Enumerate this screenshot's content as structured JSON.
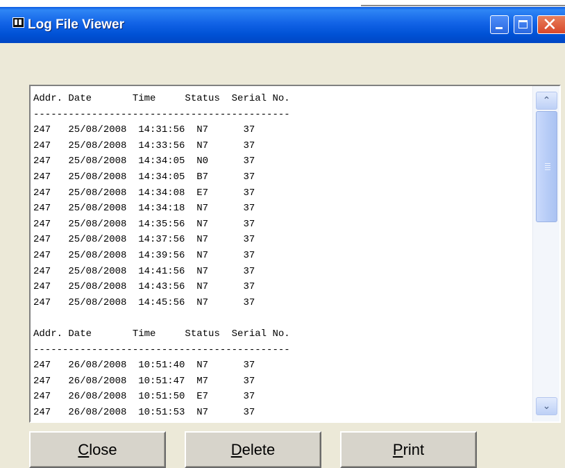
{
  "window": {
    "title": "Log File Viewer"
  },
  "log": {
    "lines": [
      "Addr. Date       Time     Status  Serial No.",
      "--------------------------------------------",
      "247   25/08/2008  14:31:56  N7      37",
      "247   25/08/2008  14:33:56  N7      37",
      "247   25/08/2008  14:34:05  N0      37",
      "247   25/08/2008  14:34:05  B7      37",
      "247   25/08/2008  14:34:08  E7      37",
      "247   25/08/2008  14:34:18  N7      37",
      "247   25/08/2008  14:35:56  N7      37",
      "247   25/08/2008  14:37:56  N7      37",
      "247   25/08/2008  14:39:56  N7      37",
      "247   25/08/2008  14:41:56  N7      37",
      "247   25/08/2008  14:43:56  N7      37",
      "247   25/08/2008  14:45:56  N7      37",
      "",
      "Addr. Date       Time     Status  Serial No.",
      "--------------------------------------------",
      "247   26/08/2008  10:51:40  N7      37",
      "247   26/08/2008  10:51:47  M7      37",
      "247   26/08/2008  10:51:50  E7      37",
      "247   26/08/2008  10:51:53  N7      37"
    ]
  },
  "buttons": {
    "close": {
      "accel": "C",
      "rest": "lose"
    },
    "delete": {
      "accel": "D",
      "rest": "elete"
    },
    "print": {
      "accel": "P",
      "rest": "rint"
    }
  },
  "icons": {
    "app": "log-viewer-icon",
    "minimize": "minimize-icon",
    "maximize": "maximize-icon",
    "close": "close-icon",
    "scroll_up": "chevron-up-icon",
    "scroll_down": "chevron-down-icon"
  },
  "colors": {
    "titlebar": "#0052d6",
    "window_bg": "#ece9d8",
    "close_button": "#d8472a"
  }
}
